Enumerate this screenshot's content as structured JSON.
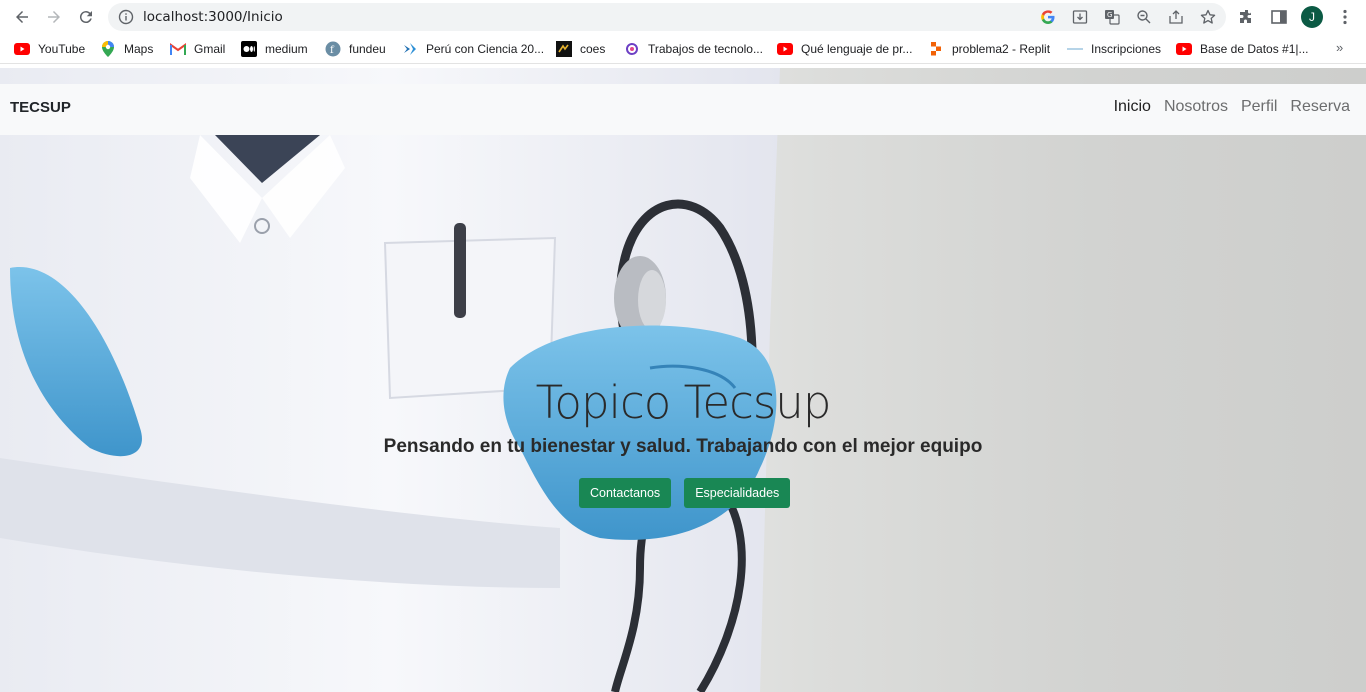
{
  "browser": {
    "url": "localhost:3000/Inicio",
    "avatar_initial": "J",
    "bookmarks": [
      {
        "label": "YouTube",
        "icon": "youtube-icon"
      },
      {
        "label": "Maps",
        "icon": "maps-icon"
      },
      {
        "label": "Gmail",
        "icon": "gmail-icon"
      },
      {
        "label": "medium",
        "icon": "medium-icon"
      },
      {
        "label": "fundeu",
        "icon": "fundeu-icon"
      },
      {
        "label": "Perú con Ciencia 20...",
        "icon": "peru-ciencia-icon"
      },
      {
        "label": "coes",
        "icon": "coes-icon"
      },
      {
        "label": "Trabajos de tecnolo...",
        "icon": "trabajos-icon"
      },
      {
        "label": "Qué lenguaje de pr...",
        "icon": "youtube-icon"
      },
      {
        "label": "problema2 - Replit",
        "icon": "replit-icon"
      },
      {
        "label": "Inscripciones",
        "icon": "dash-icon"
      },
      {
        "label": "Base de Datos #1|...",
        "icon": "youtube-icon"
      }
    ],
    "more": "»"
  },
  "navbar": {
    "brand": "TECSUP",
    "links": [
      "Inicio",
      "Nosotros",
      "Perfil",
      "Reserva"
    ]
  },
  "hero": {
    "title": "Topico Tecsup",
    "subtitle": "Pensando en tu bienestar y salud. Trabajando con el mejor equipo",
    "buttons": [
      "Contactanos",
      "Especialidades"
    ]
  },
  "colors": {
    "button_bg": "#198754",
    "navbar_bg": "#f8f9fa",
    "avatar_bg": "#0b5a44"
  }
}
